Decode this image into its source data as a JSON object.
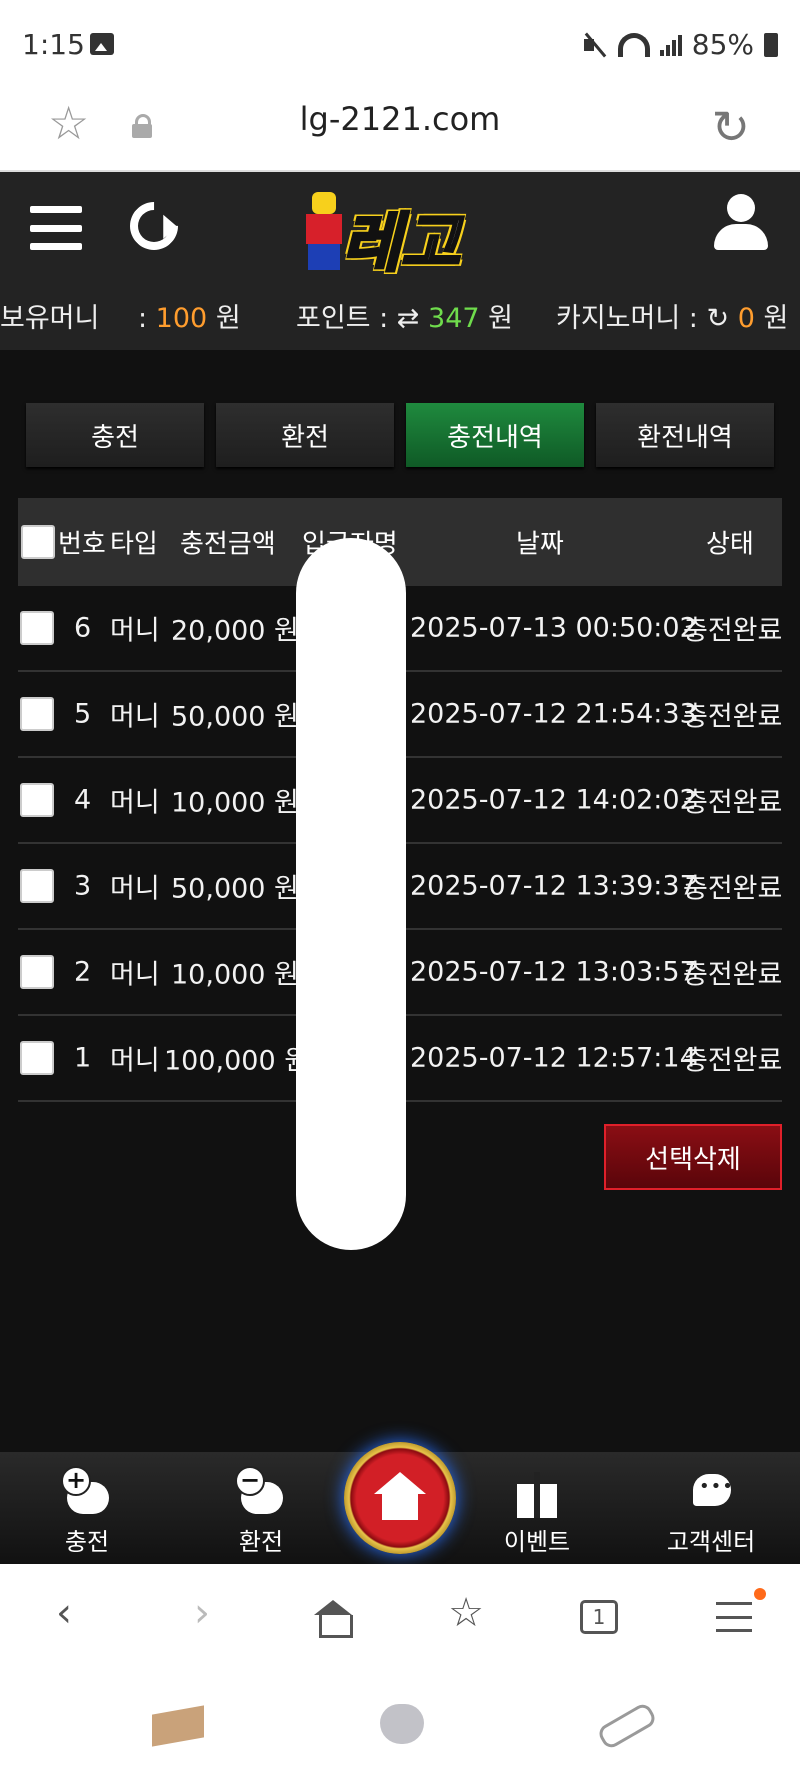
{
  "status_bar": {
    "time": "1:15",
    "battery": "85%"
  },
  "browser": {
    "url": "lg-2121.com",
    "tab_count": "1"
  },
  "site": {
    "logo_text": "레고",
    "balances": {
      "holding_label": "보유머니",
      "holding_sep": ":",
      "holding_value": "100",
      "holding_unit": "원",
      "point_label": "포인트 :",
      "point_icon": "⇄",
      "point_value": "347",
      "point_unit": "원",
      "casino_label": "카지노머니 :",
      "casino_icon": "↻",
      "casino_value": "0",
      "casino_unit": "원"
    }
  },
  "tabs": [
    {
      "label": "충전",
      "active": false
    },
    {
      "label": "환전",
      "active": false
    },
    {
      "label": "충전내역",
      "active": true
    },
    {
      "label": "환전내역",
      "active": false
    }
  ],
  "table": {
    "headers": {
      "no": "번호",
      "type": "타입",
      "amount": "충전금액",
      "depositor": "입금자명",
      "date": "날짜",
      "status": "상태"
    },
    "rows": [
      {
        "no": "6",
        "type": "머니",
        "amount": "20,000 원",
        "date": "2025-07-13 00:50:02",
        "status": "충전완료"
      },
      {
        "no": "5",
        "type": "머니",
        "amount": "50,000 원",
        "date": "2025-07-12 21:54:33",
        "status": "충전완료"
      },
      {
        "no": "4",
        "type": "머니",
        "amount": "10,000 원",
        "date": "2025-07-12 14:02:02",
        "status": "충전완료"
      },
      {
        "no": "3",
        "type": "머니",
        "amount": "50,000 원",
        "date": "2025-07-12 13:39:37",
        "status": "충전완료"
      },
      {
        "no": "2",
        "type": "머니",
        "amount": "10,000 원",
        "date": "2025-07-12 13:03:57",
        "status": "충전완료"
      },
      {
        "no": "1",
        "type": "머니",
        "amount": "100,000 원",
        "date": "2025-07-12 12:57:14",
        "status": "충전완료"
      }
    ]
  },
  "delete_button": "선택삭제",
  "bottom_nav": {
    "charge": "충전",
    "exchange": "환전",
    "event": "이벤트",
    "support": "고객센터"
  },
  "colors": {
    "accent_green": "#1f8a3e",
    "delete_red": "#8a0e14",
    "money_orange": "#ff9d2e",
    "point_green": "#6fdc4c"
  }
}
